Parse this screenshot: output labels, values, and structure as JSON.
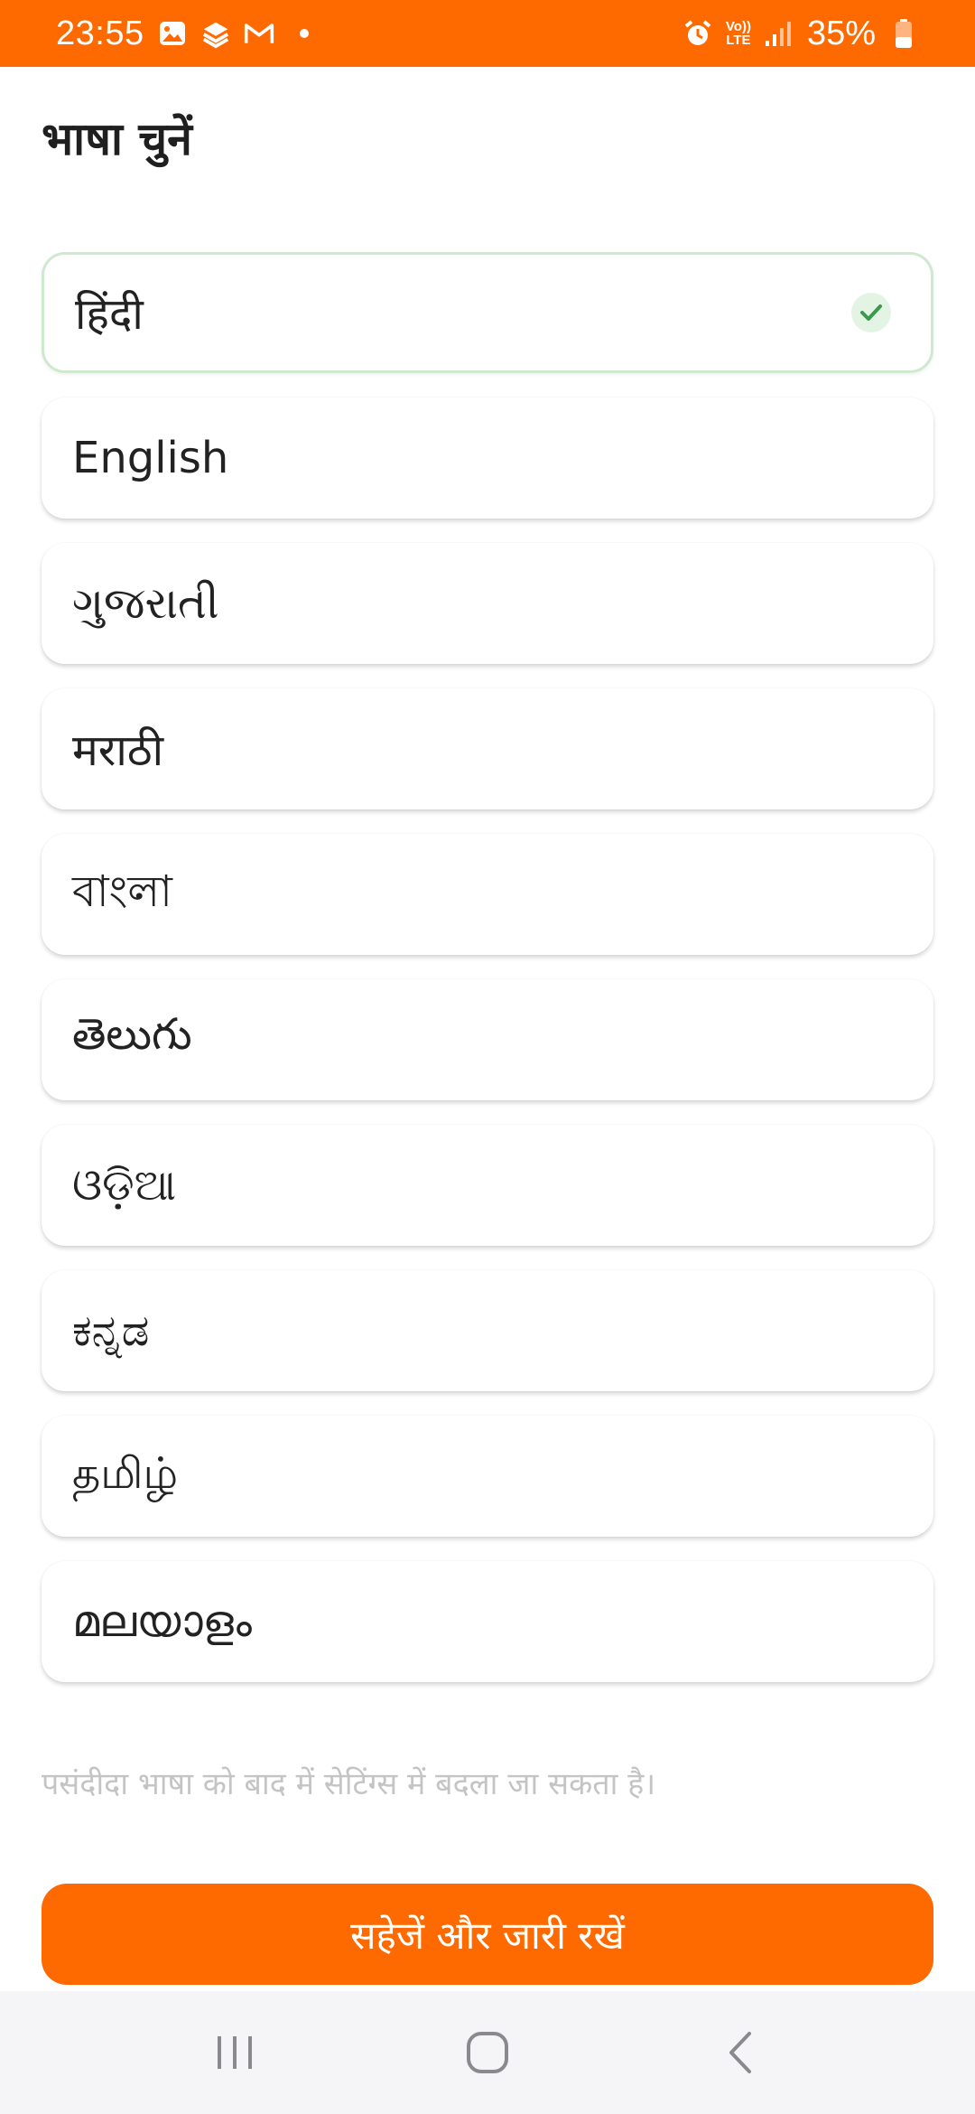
{
  "status_bar": {
    "time": "23:55",
    "battery": "35%",
    "lte_top": "Vo))",
    "lte_bottom": "LTE",
    "background": "#ff6a00"
  },
  "page": {
    "title": "भाषा चुनें",
    "hint": "पसंदीदा भाषा को बाद में सेटिंग्स में बदला जा सकता है।",
    "continue_label": "सहेजें और जारी रखें",
    "accent": "#ff6a00"
  },
  "languages": [
    {
      "label": "हिंदी",
      "selected": true
    },
    {
      "label": "English",
      "selected": false
    },
    {
      "label": "ગુજરાતી",
      "selected": false
    },
    {
      "label": "मराठी",
      "selected": false
    },
    {
      "label": "বাংলা",
      "selected": false
    },
    {
      "label": "తెలుగు",
      "selected": false
    },
    {
      "label": "ଓଡ଼ିଆ",
      "selected": false
    },
    {
      "label": "ಕನ್ನಡ",
      "selected": false
    },
    {
      "label": "தமிழ்",
      "selected": false
    },
    {
      "label": "മലയാളം",
      "selected": false
    }
  ],
  "icons": {
    "status": [
      "gallery-icon",
      "stack-icon",
      "gmail-icon",
      "alarm-icon",
      "signal-icon",
      "battery-icon"
    ],
    "selected": "check-icon",
    "nav": [
      "recents-icon",
      "home-icon",
      "back-icon"
    ]
  }
}
